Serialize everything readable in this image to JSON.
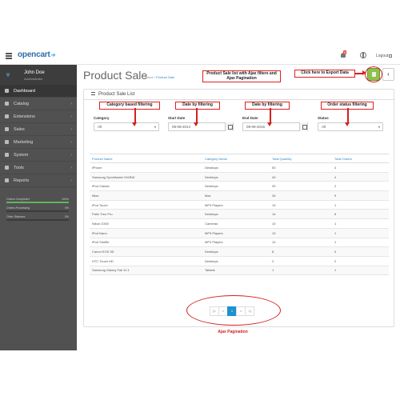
{
  "header": {
    "brand": "opencart",
    "brand_mark": "➔",
    "notification_count": "5",
    "logout_label": "Logout"
  },
  "profile": {
    "name": "John Doe",
    "role": "Administrator"
  },
  "sidebar": {
    "items": [
      {
        "label": "Dashboard",
        "icon": "dashboard-icon",
        "active": true
      },
      {
        "label": "Catalog",
        "icon": "tag-icon"
      },
      {
        "label": "Extensions",
        "icon": "puzzle-icon"
      },
      {
        "label": "Sales",
        "icon": "cart-icon"
      },
      {
        "label": "Marketing",
        "icon": "share-icon"
      },
      {
        "label": "System",
        "icon": "cog-icon"
      },
      {
        "label": "Tools",
        "icon": "wrench-icon"
      },
      {
        "label": "Reports",
        "icon": "chart-icon"
      }
    ],
    "stats": [
      {
        "label": "Orders Completed",
        "value": "100%",
        "fill": 1.0
      },
      {
        "label": "Orders Processing",
        "value": "0%",
        "fill": 0.0
      },
      {
        "label": "Other Statuses",
        "value": "0%",
        "fill": 0.0
      }
    ]
  },
  "page": {
    "title": "Product Sale",
    "breadcrumb_home": "Home",
    "breadcrumb_sep": "/",
    "breadcrumb_current": "Product Sale",
    "panel_title": "Product Sale List"
  },
  "filters": {
    "category": {
      "label": "Category",
      "value": "All"
    },
    "start_date": {
      "label": "Start Date",
      "value": "09-09-2014"
    },
    "end_date": {
      "label": "End Date",
      "value": "09-09-2015"
    },
    "status": {
      "label": "Status",
      "value": "All"
    }
  },
  "table": {
    "headers": [
      "Product Name",
      "Category Name",
      "Total Quantity",
      "Total Orders"
    ],
    "rows": [
      [
        "iPhone",
        "Desktops",
        "50",
        "4"
      ],
      [
        "Samsung SyncMaster 941BW",
        "Desktops",
        "40",
        "4"
      ],
      [
        "iPod Classic",
        "Desktops",
        "30",
        "2"
      ],
      [
        "iMac",
        "Mac",
        "26",
        "9"
      ],
      [
        "iPod Touch",
        "MP3 Players",
        "19",
        "1"
      ],
      [
        "Palm Treo Pro",
        "Desktops",
        "14",
        "6"
      ],
      [
        "Nikon D300",
        "Cameras",
        "10",
        "1"
      ],
      [
        "iPod Nano",
        "MP3 Players",
        "10",
        "1"
      ],
      [
        "iPod Shuffle",
        "MP3 Players",
        "10",
        "1"
      ],
      [
        "Canon EOS 5D",
        "Desktops",
        "8",
        "4"
      ],
      [
        "HTC Touch HD",
        "Desktops",
        "2",
        "2"
      ],
      [
        "Samsung Galaxy Tab 10.1",
        "Tablets",
        "1",
        "1"
      ]
    ]
  },
  "pagination": {
    "first": "|<",
    "prev": "<",
    "current": "1",
    "next": ">",
    "last": ">|"
  },
  "annotations": {
    "list_note": "Product Sale list with Ajax filters and Ajax Pagination",
    "export_note": "Click here to Export Data",
    "category_note": "Category based filtering",
    "date_note_1": "Date by filtering",
    "date_note_2": "Date by filtering",
    "status_note": "Order status filtering",
    "pagination_note": "Ajax Pagination"
  },
  "colors": {
    "accent": "#1e91cf",
    "annotation": "#d42020",
    "export_button": "#8fbf4f",
    "sidebar_bg": "#515151"
  }
}
